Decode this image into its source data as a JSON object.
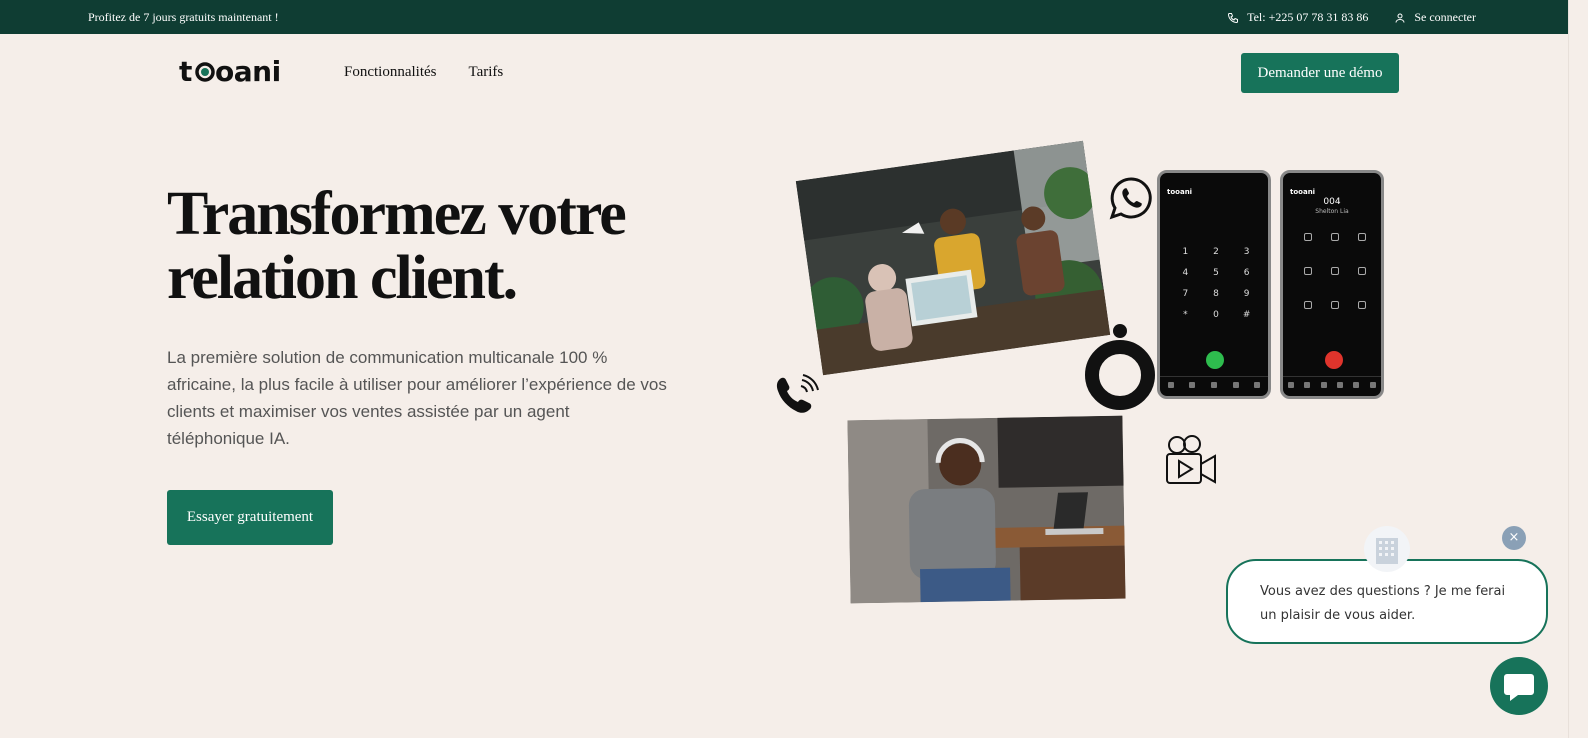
{
  "topbar": {
    "promo": "Profitez de 7 jours gratuits maintenant !",
    "phone": "Tel: +225 07 78 31 83 86",
    "login": "Se connecter"
  },
  "brand": {
    "logo_text": "tooani",
    "accent": "#17735a"
  },
  "nav": {
    "items": [
      {
        "label": "Fonctionnalités"
      },
      {
        "label": "Tarifs"
      }
    ],
    "cta": "Demander une démo"
  },
  "hero": {
    "title_line1": "Transformez votre",
    "title_line2": "relation client.",
    "description": "La première solution de communication multicanale 100 % africaine, la plus facile à utiliser pour améliorer l’expérience de vos clients et maximiser vos ventes assistée par un agent téléphonique IA.",
    "cta": "Essayer gratuitement"
  },
  "phones": {
    "left_brand": "tooani",
    "right_brand": "tooani",
    "keypad": [
      "1",
      "2",
      "3",
      "4",
      "5",
      "6",
      "7",
      "8",
      "9",
      "*",
      "0",
      "#"
    ],
    "call_number": "004",
    "caller_name": "Shelton Lia"
  },
  "icons": [
    "whatsapp-icon",
    "phone-ringing-icon",
    "video-camera-icon",
    "tooani-mark-icon"
  ],
  "chat": {
    "message": "Vous avez des questions ? Je me ferai un plaisir de vous aider.",
    "close": "×"
  },
  "colors": {
    "topbar": "#0f3d33",
    "background": "#f5eee9",
    "primary": "#17735a"
  }
}
